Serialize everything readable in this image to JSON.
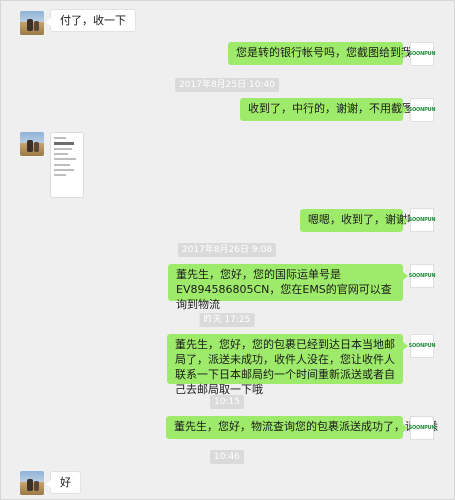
{
  "messages": {
    "m1": "付了，收一下",
    "m2": "您是转的银行帐号吗，您截图给到我吧",
    "t1": "2017年8月25日 10:40",
    "m3": "收到了，中行的，谢谢，不用截图了",
    "m4": "嗯嗯，收到了，谢谢啊",
    "t2": "2017年8月26日 9:08",
    "m5": "董先生，您好，您的国际运单号是EV894586805CN，您在EMS的官网可以查询到物流",
    "t3": "昨天 17:25",
    "m6": "董先生，您好，您的包裹已经到达日本当地邮局了，派送未成功，收件人没在，您让收件人联系一下日本邮局约一个时间重新派送或者自己去邮局取一下哦",
    "t4": "10:15",
    "m7": "董先生，您好，物流查询您的包裹派送成功了，请知悉",
    "t5": "10:46",
    "m8": "好"
  },
  "brand": {
    "avatar_text": "SOONPUN",
    "bubble_color": "#9eea6a",
    "avatar_text_color": "#1f8e3c"
  }
}
